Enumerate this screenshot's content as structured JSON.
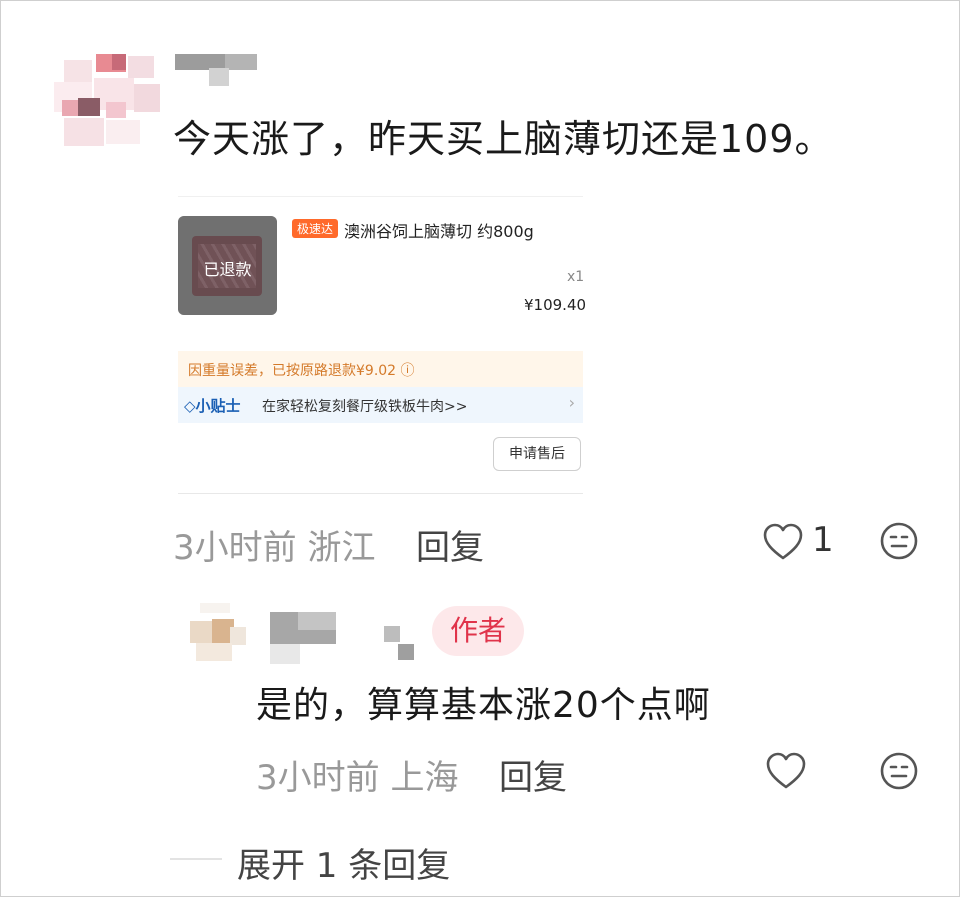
{
  "comment": {
    "text": "今天涨了，昨天买上脑薄切还是109。",
    "time": "3小时前",
    "location": "浙江",
    "reply_label": "回复",
    "like_count": "1"
  },
  "order_card": {
    "refund_overlay": "已退款",
    "tag": "极速达",
    "product_title": "澳洲谷饲上脑薄切 约800g",
    "quantity": "x1",
    "price": "¥109.40",
    "notice": "因重量误差，已按原路退款¥9.02 ⓘ",
    "tip_label": "◇小贴士",
    "tip_text": "在家轻松复刻餐厅级铁板牛肉>>",
    "tip_arrow": "›",
    "after_sale_button": "申请售后"
  },
  "reply": {
    "author_tag": "作者",
    "text": "是的，算算基本涨20个点啊",
    "time": "3小时前",
    "location": "上海",
    "reply_label": "回复"
  },
  "expand_replies": "展开 1 条回复",
  "colors": {
    "author_tag_bg": "#fde8ea",
    "author_tag_text": "#e0334a",
    "tag_orange": "#ff6a2b",
    "notice_text": "#d47a2a",
    "tip_blue": "#1a5fb4"
  }
}
